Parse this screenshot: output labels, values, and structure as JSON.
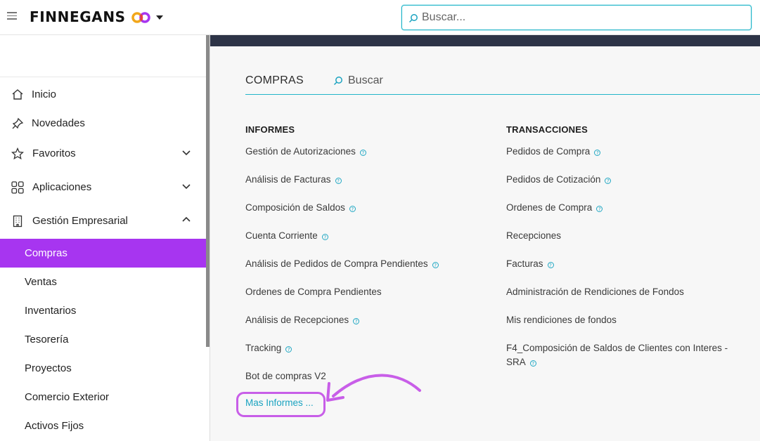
{
  "header": {
    "brand": "FINNEGANS",
    "search_placeholder": "Buscar..."
  },
  "sidebar": {
    "items": [
      {
        "label": "Inicio",
        "icon": "home-icon"
      },
      {
        "label": "Novedades",
        "icon": "pin-icon"
      },
      {
        "label": "Favoritos",
        "icon": "star-icon",
        "expanded": false
      },
      {
        "label": "Aplicaciones",
        "icon": "grid-icon",
        "expanded": false
      },
      {
        "label": "Gestión Empresarial",
        "icon": "building-icon",
        "expanded": true
      }
    ],
    "sub_items": [
      {
        "label": "Compras",
        "active": true
      },
      {
        "label": "Ventas"
      },
      {
        "label": "Inventarios"
      },
      {
        "label": "Tesorería"
      },
      {
        "label": "Proyectos"
      },
      {
        "label": "Comercio Exterior"
      },
      {
        "label": "Activos Fijos"
      }
    ]
  },
  "main": {
    "module_title": "COMPRAS",
    "search_placeholder": "Buscar",
    "informes": {
      "heading": "INFORMES",
      "items": [
        {
          "label": "Gestión de Autorizaciones",
          "help": true
        },
        {
          "label": "Análisis de Facturas",
          "help": true
        },
        {
          "label": "Composición de Saldos",
          "help": true
        },
        {
          "label": "Cuenta Corriente",
          "help": true
        },
        {
          "label": "Análisis de Pedidos de Compra Pendientes",
          "help": true
        },
        {
          "label": "Ordenes de Compra Pendientes",
          "help": false
        },
        {
          "label": "Análisis de Recepciones",
          "help": true
        },
        {
          "label": "Tracking",
          "help": true
        },
        {
          "label": "Bot de compras V2",
          "help": false
        }
      ],
      "more_label": "Mas Informes ..."
    },
    "transacciones": {
      "heading": "TRANSACCIONES",
      "items": [
        {
          "label": "Pedidos de Compra",
          "help": true
        },
        {
          "label": "Pedidos de Cotización",
          "help": true
        },
        {
          "label": "Ordenes de Compra",
          "help": true
        },
        {
          "label": "Recepciones",
          "help": false
        },
        {
          "label": "Facturas",
          "help": true
        },
        {
          "label": "Administración de Rendiciones de Fondos",
          "help": false
        },
        {
          "label": "Mis rendiciones de fondos",
          "help": false
        },
        {
          "label": "F4_Composición de Saldos de Clientes con Interes -",
          "help": false
        },
        {
          "label": "SRA",
          "help": true
        }
      ]
    }
  },
  "colors": {
    "accent": "#a735f0",
    "link": "#1aa3c0",
    "banner": "#2d3447",
    "annotation": "#c85ee8"
  }
}
